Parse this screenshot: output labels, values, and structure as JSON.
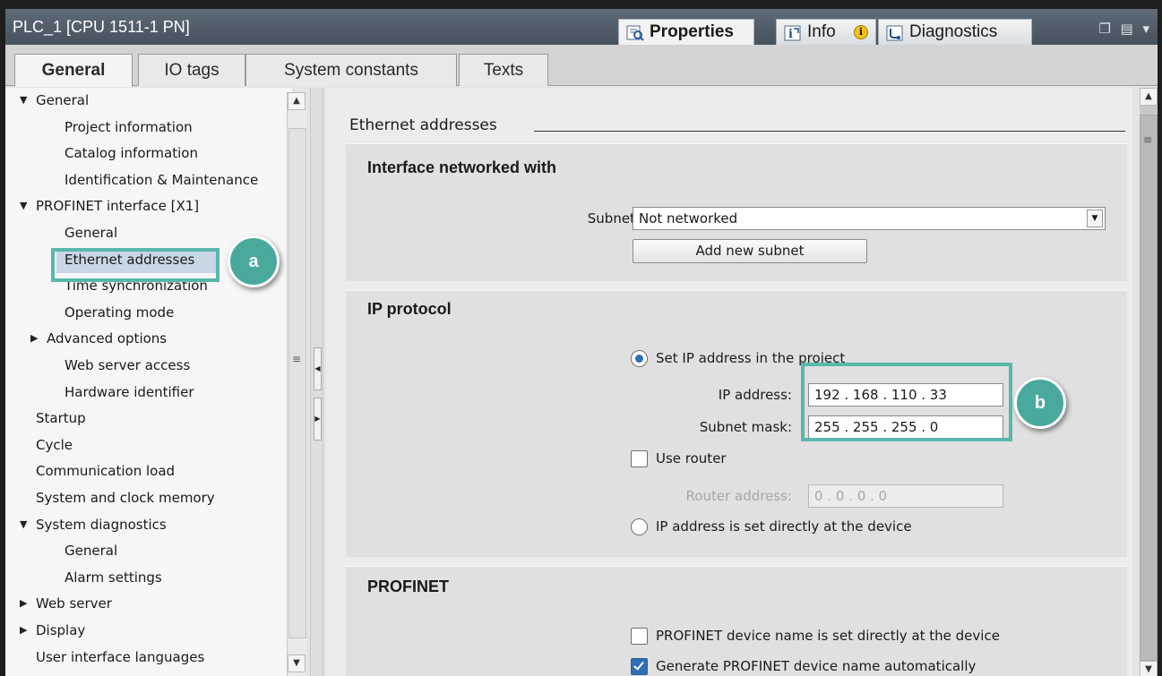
{
  "window": {
    "title": "PLC_1 [CPU 1511-1 PN]",
    "tabs": [
      {
        "label": "Properties",
        "icon": "properties-icon",
        "active": true
      },
      {
        "label": "Info",
        "icon": "info-icon",
        "active": false
      },
      {
        "label": "Diagnostics",
        "icon": "diagnostics-icon",
        "active": false
      }
    ],
    "info_badge": "i",
    "controls": "❐ ▤ ▾"
  },
  "subtabs": [
    {
      "label": "General",
      "active": true
    },
    {
      "label": "IO tags",
      "active": false
    },
    {
      "label": "System constants",
      "active": false
    },
    {
      "label": "Texts",
      "active": false
    }
  ],
  "tree": [
    {
      "label": "General",
      "level": 0,
      "expander": "expanded"
    },
    {
      "label": "Project information",
      "level": 2,
      "expander": "none"
    },
    {
      "label": "Catalog information",
      "level": 2,
      "expander": "none"
    },
    {
      "label": "Identification & Maintenance",
      "level": 2,
      "expander": "none"
    },
    {
      "label": "PROFINET interface [X1]",
      "level": 0,
      "expander": "expanded"
    },
    {
      "label": "General",
      "level": 2,
      "expander": "none"
    },
    {
      "label": "Ethernet addresses",
      "level": 2,
      "expander": "none",
      "selected": true
    },
    {
      "label": "Time synchronization",
      "level": 2,
      "expander": "none"
    },
    {
      "label": "Operating mode",
      "level": 2,
      "expander": "none"
    },
    {
      "label": "Advanced options",
      "level": 1,
      "expander": "collapsed"
    },
    {
      "label": "Web server access",
      "level": 2,
      "expander": "none"
    },
    {
      "label": "Hardware identifier",
      "level": 2,
      "expander": "none"
    },
    {
      "label": "Startup",
      "level": 0,
      "expander": "none"
    },
    {
      "label": "Cycle",
      "level": 0,
      "expander": "none"
    },
    {
      "label": "Communication load",
      "level": 0,
      "expander": "none"
    },
    {
      "label": "System and clock memory",
      "level": 0,
      "expander": "none"
    },
    {
      "label": "System diagnostics",
      "level": 0,
      "expander": "expanded"
    },
    {
      "label": "General",
      "level": 2,
      "expander": "none"
    },
    {
      "label": "Alarm settings",
      "level": 2,
      "expander": "none"
    },
    {
      "label": "Web server",
      "level": 0,
      "expander": "collapsed"
    },
    {
      "label": "Display",
      "level": 0,
      "expander": "collapsed"
    },
    {
      "label": "User interface languages",
      "level": 0,
      "expander": "none"
    }
  ],
  "content": {
    "heading": "Ethernet addresses",
    "interface": {
      "title": "Interface networked with",
      "subnet_label": "Subnet:",
      "subnet_value": "Not networked",
      "add_subnet_button": "Add new subnet"
    },
    "ip": {
      "title": "IP protocol",
      "set_in_project_label": "Set IP address in the project",
      "set_in_project_selected": true,
      "ip_label": "IP address:",
      "ip_value": "192 . 168 . 110 . 33",
      "mask_label": "Subnet mask:",
      "mask_value": "255 . 255 . 255 . 0",
      "use_router_label": "Use router",
      "use_router_checked": false,
      "router_label": "Router address:",
      "router_value": "0    .  0    .  0    .  0",
      "set_at_device_label": "IP address is set directly at the device",
      "set_at_device_selected": false
    },
    "profinet": {
      "title": "PROFINET",
      "name_at_device_label": "PROFINET device name is set directly at the device",
      "name_at_device_checked": false,
      "generate_name_label": "Generate PROFINET device name automatically",
      "generate_name_checked": true
    }
  },
  "annotations": {
    "a": "a",
    "b": "b",
    "accent_color": "#59b7ac"
  }
}
